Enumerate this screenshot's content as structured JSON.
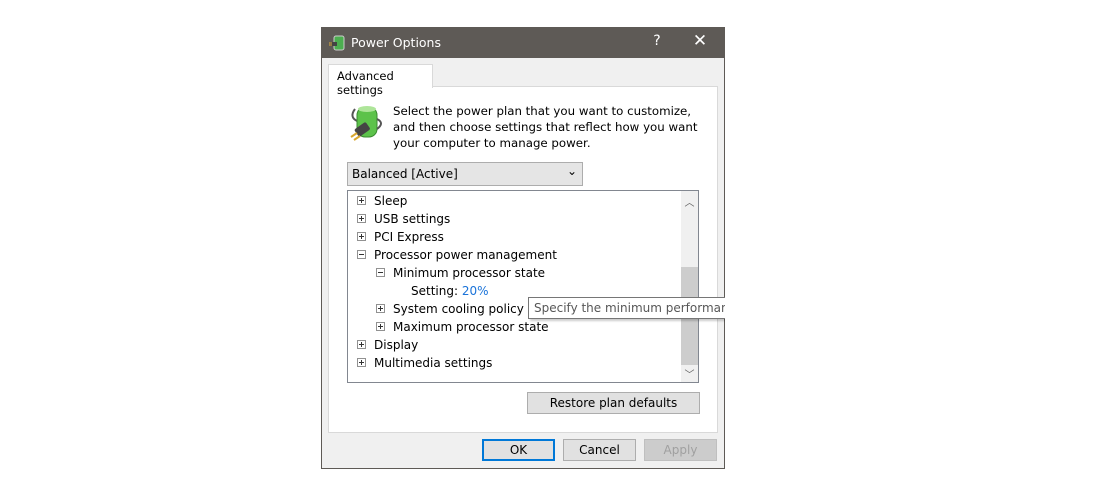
{
  "window": {
    "title": "Power Options",
    "help": "?",
    "close": "✕"
  },
  "tab": {
    "label": "Advanced settings"
  },
  "description": "Select the power plan that you want to customize, and then choose settings that reflect how you want your computer to manage power.",
  "plan_dropdown": {
    "value": "Balanced [Active]"
  },
  "tree": {
    "items": [
      {
        "label": "Sleep",
        "expanded": false
      },
      {
        "label": "USB settings",
        "expanded": false
      },
      {
        "label": "PCI Express",
        "expanded": false
      },
      {
        "label": "Processor power management",
        "expanded": true
      },
      {
        "label": "Minimum processor state",
        "expanded": true
      },
      {
        "label": "Setting:",
        "value": "20%"
      },
      {
        "label": "System cooling policy",
        "expanded": false
      },
      {
        "label": "Maximum processor state",
        "expanded": false
      },
      {
        "label": "Display",
        "expanded": false
      },
      {
        "label": "Multimedia settings",
        "expanded": false
      }
    ]
  },
  "tooltip": "Specify the minimum performance s",
  "buttons": {
    "restore": "Restore plan defaults",
    "ok": "OK",
    "cancel": "Cancel",
    "apply": "Apply"
  },
  "colors": {
    "titlebar": "#5e5a56",
    "link": "#1a73d9",
    "accent": "#0078d7"
  }
}
